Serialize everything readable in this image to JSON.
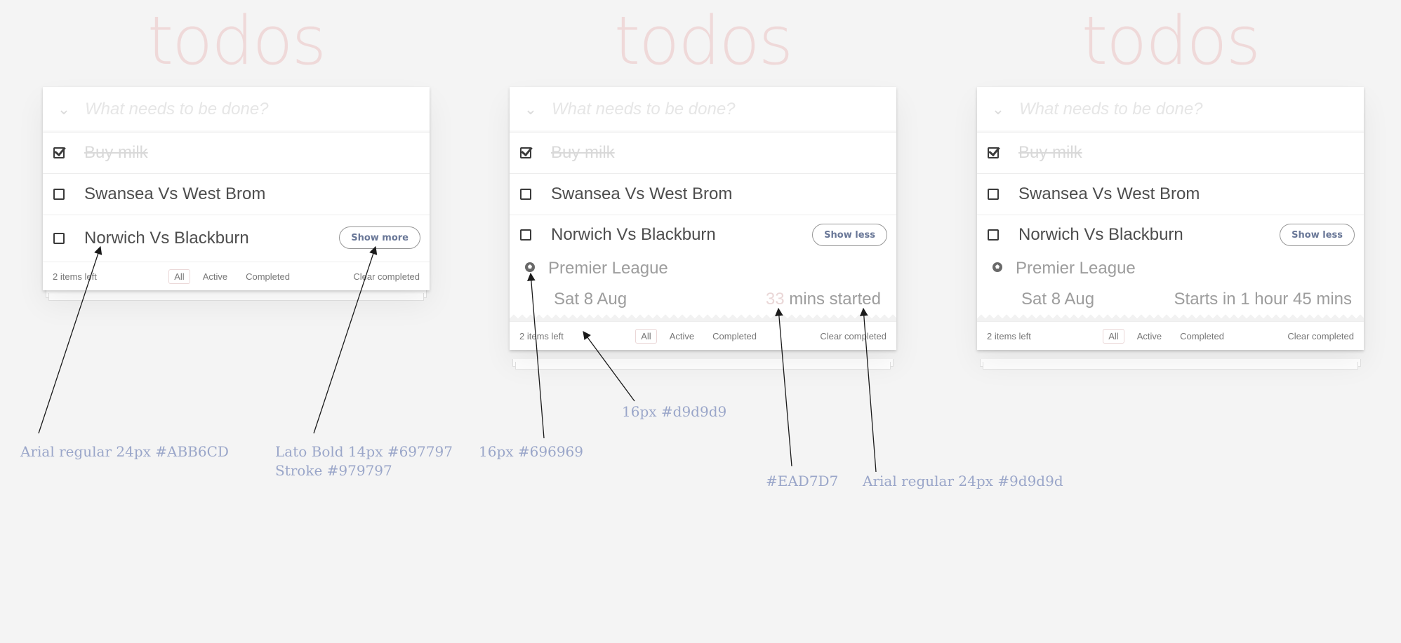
{
  "app": {
    "logo": "todos"
  },
  "input": {
    "placeholder": "What needs to be done?",
    "toggle_glyph": "⌄"
  },
  "todos": [
    {
      "label": "Buy milk",
      "completed": true
    },
    {
      "label": "Swansea Vs West Brom",
      "completed": false
    },
    {
      "label": "Norwich Vs Blackburn",
      "completed": false
    }
  ],
  "buttons": {
    "show_more": "Show more",
    "show_less": "Show less"
  },
  "details": {
    "league": "Premier League",
    "date": "Sat 8 Aug",
    "status_minutes": "33",
    "status_suffix": " mins started",
    "status_upcoming": "Starts in 1 hour 45 mins",
    "league_icon": "soccer-ball-icon"
  },
  "footer": {
    "items_left": "2 items left",
    "filters": [
      "All",
      "Active",
      "Completed"
    ],
    "clear": "Clear completed"
  },
  "annotations": {
    "title_font": "Arial regular 24px  #ABB6CD",
    "button_font_line1": "Lato Bold 14px  #697797",
    "button_font_line2": "Stroke #979797",
    "icon_spec": "16px #696969",
    "separator_spec": "16px #d9d9d9",
    "minutes_color": "#EAD7D7",
    "details_font": "Arial regular 24px  #9d9d9d"
  },
  "colors": {
    "background": "#f4f4f4",
    "logo": "#efd9d9",
    "button_text": "#697797",
    "button_stroke": "#979797",
    "detail_text": "#9d9d9d",
    "minutes": "#ead7d7",
    "annotation": "#9aa6c9"
  }
}
